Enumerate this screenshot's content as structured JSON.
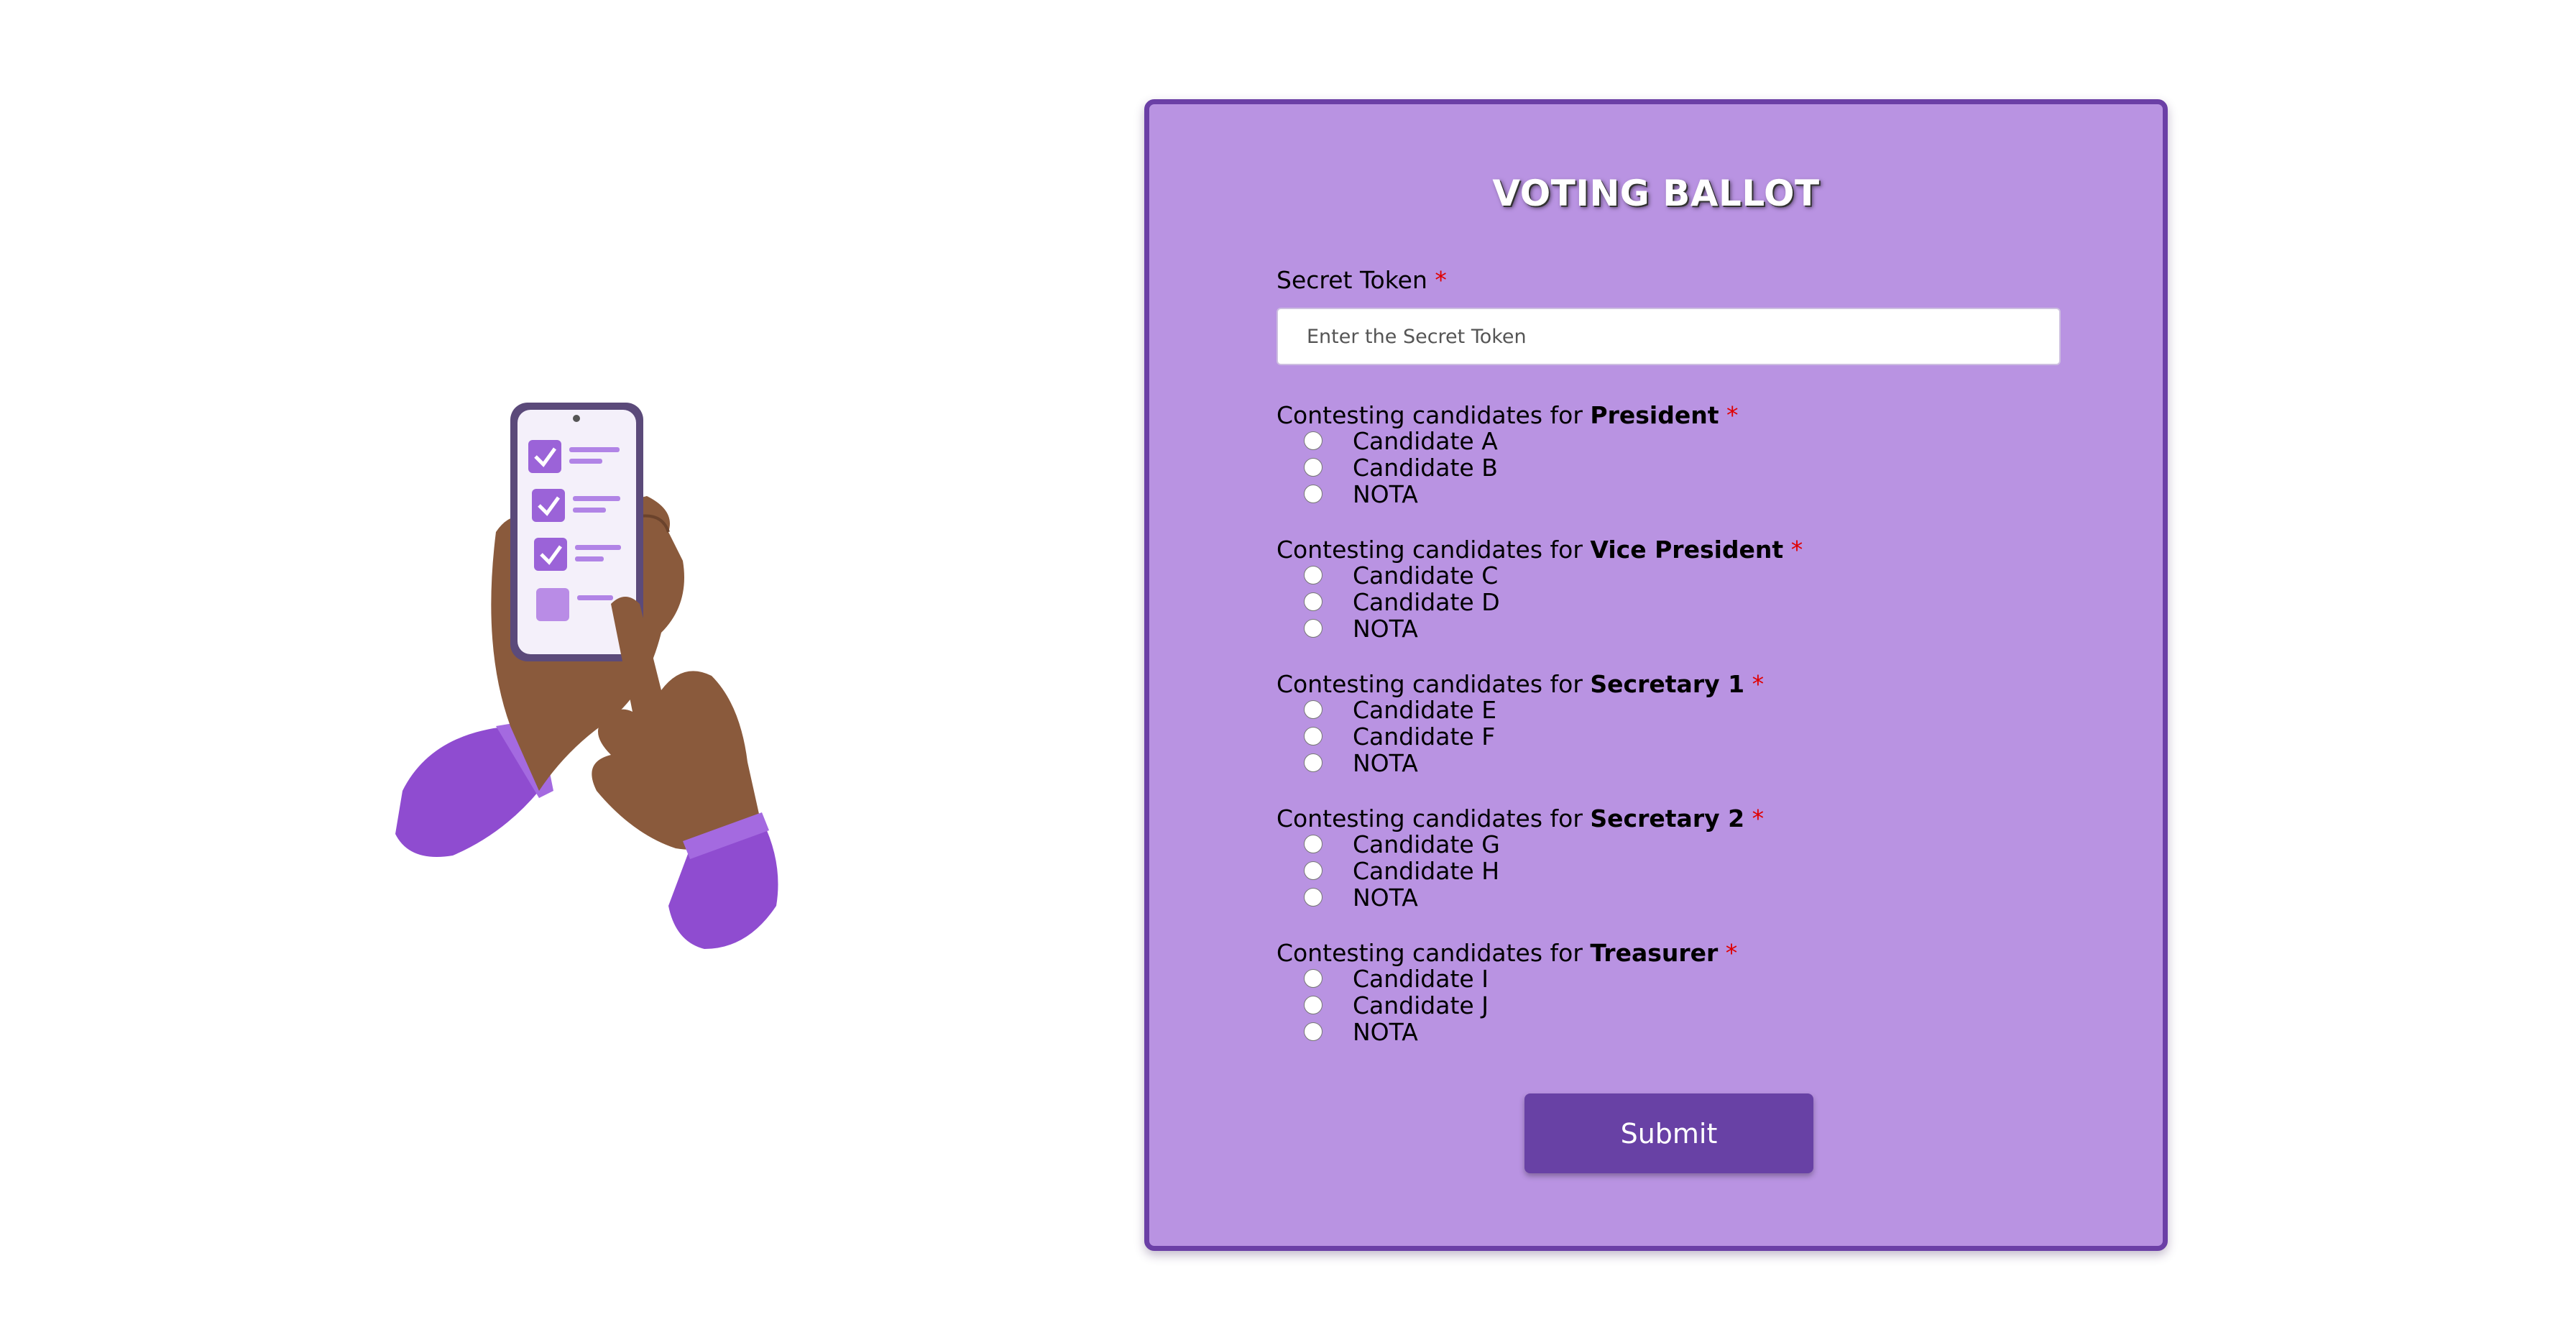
{
  "ballot": {
    "title": "VOTING BALLOT",
    "token_label": "Secret Token",
    "token_required": "*",
    "token_placeholder": "Enter the Secret Token",
    "prefix": "Contesting candidates for ",
    "required_mark": "*",
    "positions": [
      {
        "name": "President",
        "candidates": [
          "Candidate A",
          "Candidate B",
          "NOTA"
        ]
      },
      {
        "name": "Vice President",
        "candidates": [
          "Candidate C",
          "Candidate D",
          "NOTA"
        ]
      },
      {
        "name": "Secretary 1",
        "candidates": [
          "Candidate E",
          "Candidate F",
          "NOTA"
        ]
      },
      {
        "name": "Secretary 2",
        "candidates": [
          "Candidate G",
          "Candidate H",
          "NOTA"
        ]
      },
      {
        "name": "Treasurer",
        "candidates": [
          "Candidate I",
          "Candidate J",
          "NOTA"
        ]
      }
    ],
    "submit_label": "Submit"
  },
  "colors": {
    "panel_bg": "#b993e2",
    "panel_border": "#6b3fa6",
    "button_bg": "#6841a5",
    "required": "#e00000"
  }
}
